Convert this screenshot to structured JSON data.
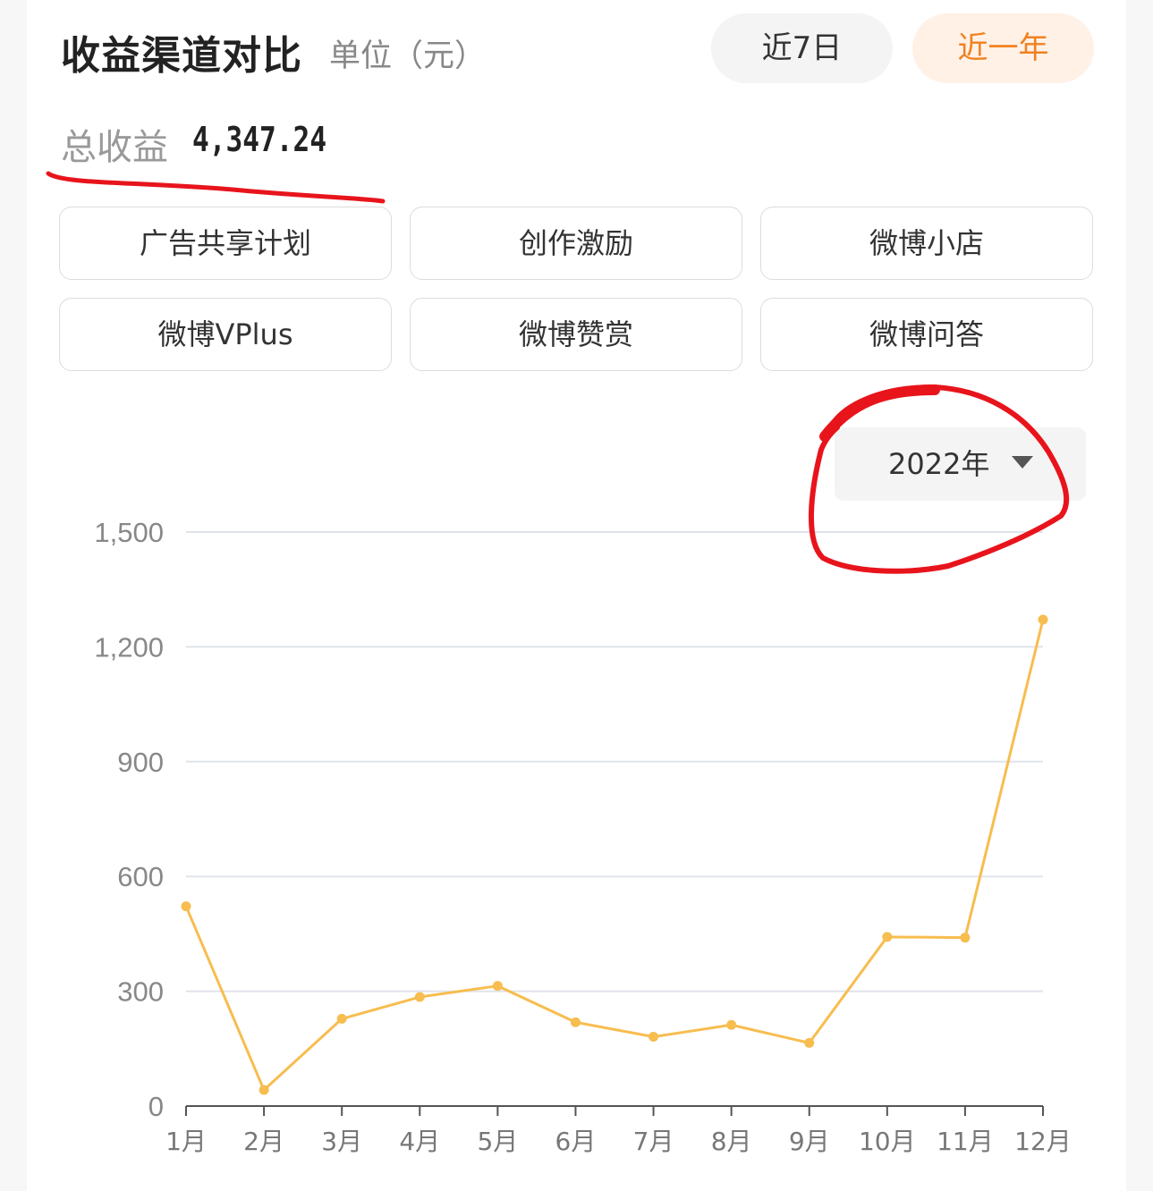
{
  "header": {
    "title": "收益渠道对比",
    "unit": "单位（元）",
    "range_tabs": [
      "近7日",
      "近一年"
    ],
    "active_tab": "近一年"
  },
  "summary": {
    "label": "总收益",
    "value": "4,347.24"
  },
  "channels": [
    "广告共享计划",
    "创作激励",
    "微博小店",
    "微博VPlus",
    "微博赞赏",
    "微博问答"
  ],
  "year_select": {
    "value": "2022年"
  },
  "colors": {
    "line": "#f7bd4f",
    "accent": "#f08121",
    "annotation": "#e8141c"
  },
  "chart_data": {
    "type": "line",
    "x": [
      "1月",
      "2月",
      "3月",
      "4月",
      "5月",
      "6月",
      "7月",
      "8月",
      "9月",
      "10月",
      "11月",
      "12月"
    ],
    "series": [
      {
        "values": [
          522,
          42,
          228,
          285,
          314,
          219,
          181,
          212,
          165,
          442,
          440,
          1271
        ]
      }
    ],
    "ylim": [
      0,
      1500
    ],
    "yticks": [
      0,
      300,
      600,
      900,
      1200,
      1500
    ],
    "ytick_labels": [
      "0",
      "300",
      "600",
      "900",
      "1,200",
      "1,500"
    ],
    "grid": true
  }
}
